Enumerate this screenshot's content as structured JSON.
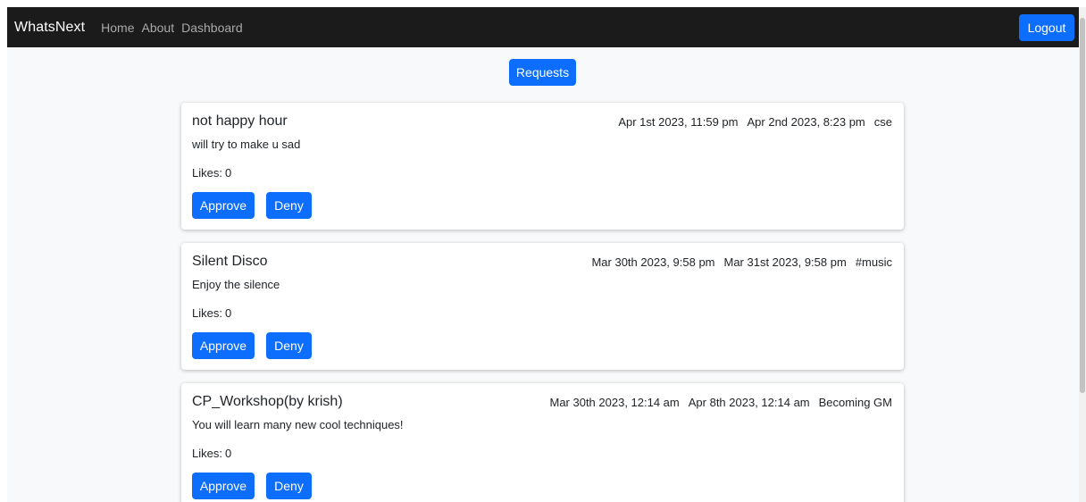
{
  "navbar": {
    "brand": "WhatsNext",
    "links": [
      "Home",
      "About",
      "Dashboard"
    ],
    "logout_label": "Logout"
  },
  "requests_label": "Requests",
  "likes_label": "Likes:",
  "approve_label": "Approve",
  "deny_label": "Deny",
  "events": [
    {
      "title": "not happy hour",
      "description": "will try to make u sad",
      "start": "Apr 1st 2023, 11:59 pm",
      "end": "Apr 2nd 2023, 8:23 pm",
      "tag": "cse",
      "likes": "0"
    },
    {
      "title": "Silent Disco",
      "description": "Enjoy the silence",
      "start": "Mar 30th 2023, 9:58 pm",
      "end": "Mar 31st 2023, 9:58 pm",
      "tag": "#music",
      "likes": "0"
    },
    {
      "title": "CP_Workshop(by krish)",
      "description": "You will learn many new cool techniques!",
      "start": "Mar 30th 2023, 12:14 am",
      "end": "Apr 8th 2023, 12:14 am",
      "tag": "Becoming GM",
      "likes": "0"
    }
  ],
  "colors": {
    "navbar_bg": "#1b1b1b",
    "primary": "#0d6efd",
    "page_bg": "#f8f9fa"
  }
}
